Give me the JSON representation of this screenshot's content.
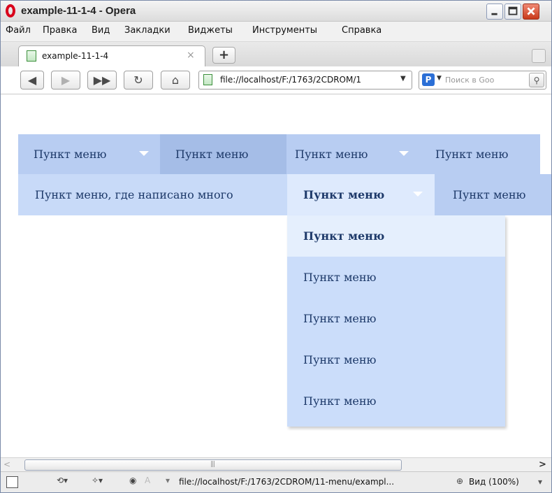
{
  "window": {
    "title": "example-11-1-4 - Opera"
  },
  "menubar": {
    "items": [
      "Файл",
      "Правка",
      "Вид",
      "Закладки",
      "Виджеты",
      "Инструменты",
      "Справка"
    ]
  },
  "tabs": [
    {
      "label": "example-11-1-4",
      "close": "×"
    }
  ],
  "newtab_label": "+",
  "nav": {
    "address": "file://localhost/F:/1763/2CDROM/1",
    "search_placeholder": "Поиск в Goo"
  },
  "menu": {
    "row1": [
      {
        "label": "Пункт меню",
        "has_caret": true
      },
      {
        "label": "Пункт меню",
        "has_caret": false
      },
      {
        "label": "Пункт меню",
        "has_caret": true
      },
      {
        "label": "Пункт меню",
        "has_caret": false
      }
    ],
    "row2": [
      {
        "label": "Пункт меню, где написано много",
        "has_caret": false
      },
      {
        "label": "Пункт меню",
        "has_caret": true
      },
      {
        "label": "Пункт меню",
        "has_caret": false
      }
    ],
    "dropdown": [
      {
        "label": "Пункт меню",
        "active": true
      },
      {
        "label": "Пункт меню",
        "active": false
      },
      {
        "label": "Пункт меню",
        "active": false
      },
      {
        "label": "Пункт меню",
        "active": false
      },
      {
        "label": "Пункт меню",
        "active": false
      }
    ]
  },
  "statusbar": {
    "url": "file://localhost/F:/1763/2CDROM/11-menu/exampl...",
    "zoom": "Вид (100%)",
    "zoom_caret": "▾",
    "a_label": "A"
  },
  "colors": {
    "row1_bg": "#b8cdf2",
    "row1_highlight": "#a5bde7",
    "row2_bg": "#c8daf8",
    "active_item": "#deeafd",
    "dropdown_bg": "#cbddfa",
    "menu_text": "#1e3a6a"
  },
  "icons": [
    "opera-logo-icon",
    "minimize-icon",
    "maximize-icon",
    "close-icon",
    "page-icon",
    "back-icon",
    "forward-icon",
    "fast-forward-icon",
    "reload-icon",
    "home-icon",
    "search-engine-icon",
    "search-go-icon",
    "trash-icon",
    "panel-toggle-icon",
    "sync-icon",
    "unite-icon",
    "turbo-icon",
    "zoom-icon"
  ]
}
